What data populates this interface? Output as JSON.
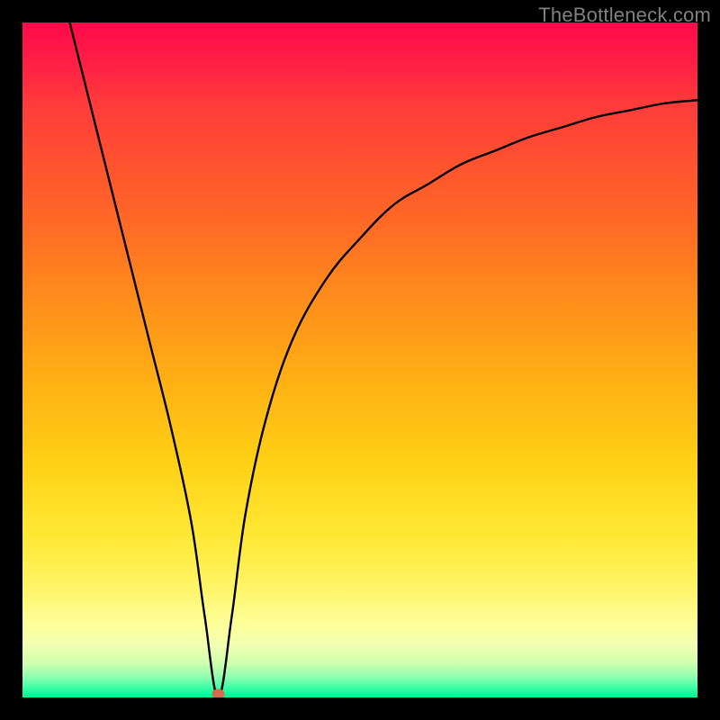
{
  "watermark": "TheBottleneck.com",
  "colors": {
    "frame": "#000000",
    "watermark": "#808080",
    "curve": "#000000",
    "marker": "#d96a50",
    "gradient_top": "#ff0a4a",
    "gradient_bottom": "#00f094"
  },
  "chart_data": {
    "type": "line",
    "title": "",
    "xlabel": "",
    "ylabel": "",
    "xlim": [
      0,
      100
    ],
    "ylim": [
      0,
      100
    ],
    "note": "Values estimated from pixels; y corresponds to vertical position (high=red, low=green). Minimum near x≈29.",
    "series": [
      {
        "name": "curve",
        "x": [
          7,
          10,
          13,
          16,
          19,
          22,
          25,
          27,
          29,
          31,
          33,
          36,
          40,
          45,
          50,
          55,
          60,
          65,
          70,
          75,
          80,
          85,
          90,
          95,
          100
        ],
        "y": [
          100,
          88,
          76,
          64,
          52,
          40,
          26,
          12,
          0,
          12,
          27,
          41,
          53,
          62,
          68,
          73,
          76,
          79,
          81,
          83,
          84.5,
          86,
          87,
          88,
          88.5
        ]
      }
    ],
    "marker": {
      "x": 29,
      "y": 0
    }
  }
}
